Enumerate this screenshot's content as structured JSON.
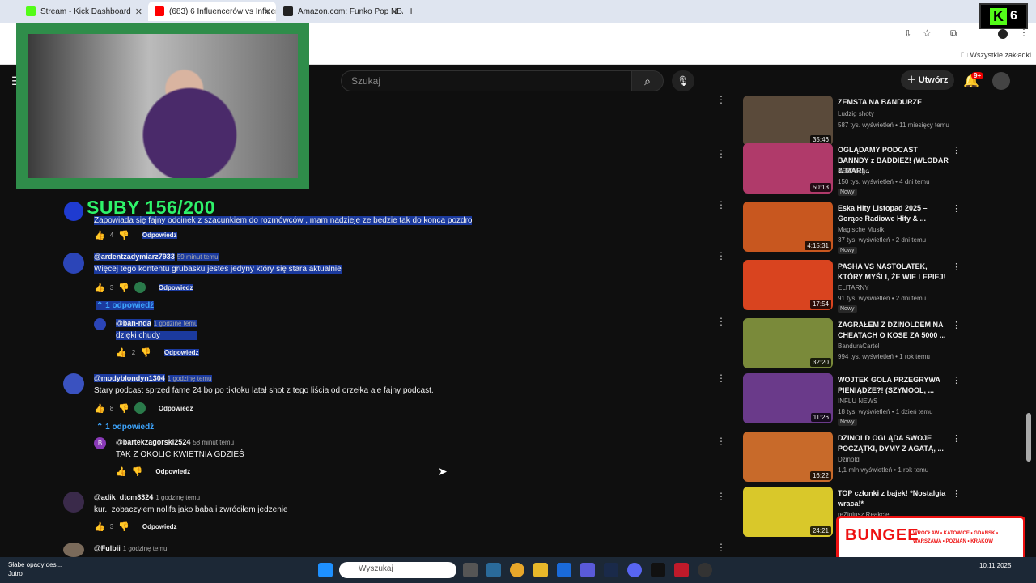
{
  "browser": {
    "tabs": [
      {
        "title": "Stream - Kick Dashboard",
        "color": "#53fc18"
      },
      {
        "title": "(683) 6 Influencerów vs Influenc",
        "color": "#ff0000"
      },
      {
        "title": "Amazon.com: Funko Pop NBA:",
        "color": "#222222"
      }
    ],
    "bookmarks_label": "Wszystkie zakładki"
  },
  "youtube": {
    "search_placeholder": "Szukaj",
    "create_label": "Utwórz",
    "notif_count": "9+"
  },
  "overlay": {
    "subs_text": "SUBY 156/200",
    "kick_count": "6"
  },
  "comments": [
    {
      "author": "",
      "time": "",
      "text": "Zapowiada się fajny odcinek z szacunkiem do rozmówców , mam nadzieje ze bedzie tak do konca pozdro",
      "likes": "4",
      "reply": "Odpowiedz"
    },
    {
      "author": "@ardentzadymiarz7933",
      "time": "59 minut temu",
      "text": "Więcej tego kontentu grubasku jesteś jedyny który się stara aktualnie",
      "likes": "3",
      "reply": "Odpowiedz",
      "replies_label": "1 odpowiedź"
    },
    {
      "author": "@ban-nda",
      "time": "1 godzinę temu",
      "text": "dzięki chudy",
      "likes": "2",
      "reply": "Odpowiedz"
    },
    {
      "author": "@modyblondyn1304",
      "time": "1 godzinę temu",
      "text": "Stary podcast sprzed fame 24 bo po tiktoku latał shot z tego liścia od orzełka ale fajny podcast.",
      "likes": "8",
      "reply": "Odpowiedz",
      "replies_label": "1 odpowiedź"
    },
    {
      "author": "@bartekzagorski2524",
      "time": "58 minut temu",
      "text": "TAK Z OKOLIC KWIETNIA GDZIEŚ",
      "likes": "",
      "reply": "Odpowiedz"
    },
    {
      "author": "@adik_dtcm8324",
      "time": "1 godzinę temu",
      "text": "kur.. zobaczyłem nolifa jako baba i zwróciłem jedzenie",
      "likes": "3",
      "reply": "Odpowiedz"
    },
    {
      "author": "@Fulbii",
      "time": "1 godzinę temu",
      "text": "",
      "likes": "",
      "reply": ""
    }
  ],
  "sidebar_videos": [
    {
      "title": "ZEMSTA NA BANDURZE",
      "channel": "Ludzig shoty",
      "meta": "587 tys. wyświetleń • 11 miesięcy temu",
      "duration": "35:46",
      "new": "",
      "color": "#5a4a3a"
    },
    {
      "title": "OGLĄDAMY PODCAST BANNDY z BADDIEZ! (WŁODAR & MARI...",
      "channel": "NEEXcsgo",
      "meta": "150 tys. wyświetleń • 4 dni temu",
      "duration": "50:13",
      "new": "Nowy",
      "color": "#b03a6a"
    },
    {
      "title": "Eska Hity Listopad 2025 – Gorące Radiowe Hity & ...",
      "channel": "Magische Musik",
      "meta": "37 tys. wyświetleń • 2 dni temu",
      "duration": "4:15:31",
      "new": "Nowy",
      "color": "#c8571f"
    },
    {
      "title": "PASHA VS NASTOLATEK, KTÓRY MYŚLI, ŻE WIE LEPIEJ!",
      "channel": "ELITARNY",
      "meta": "91 tys. wyświetleń • 2 dni temu",
      "duration": "17:54",
      "new": "Nowy",
      "color": "#d9441f"
    },
    {
      "title": "ZAGRAŁEM Z DZINOLDEM NA CHEATACH O KOSE ZA 5000 ...",
      "channel": "BanduraCartel",
      "meta": "994 tys. wyświetleń • 1 rok temu",
      "duration": "32:20",
      "new": "",
      "color": "#7a8a3a"
    },
    {
      "title": "WOJTEK GOLA PRZEGRYWA PIENIĄDZE?! (SZYMOOL, ...",
      "channel": "INFLU NEWS",
      "meta": "18 tys. wyświetleń • 1 dzień temu",
      "duration": "11:26",
      "new": "Nowy",
      "color": "#6a3a8a"
    },
    {
      "title": "DZINOLD OGLĄDA SWOJE POCZĄTKI, DYMY Z AGATĄ, ...",
      "channel": "Dzinold",
      "meta": "1,1 mln wyświetleń • 1 rok temu",
      "duration": "16:22",
      "new": "",
      "color": "#c86a2a"
    },
    {
      "title": "TOP członki z bajek! *Nostalgia wraca!*",
      "channel": "reZigiusz Reakcje",
      "meta": "",
      "duration": "24:21",
      "new": "",
      "color": "#d9c82a"
    }
  ],
  "ad": {
    "brand": "BUNGEE",
    "cities": "WROCŁAW • KATOWICE • GDAŃSK • WARSZAWA • POZNAŃ • KRAKÓW"
  },
  "taskbar": {
    "weather_title": "Słabe opady des...",
    "weather_sub": "Jutro",
    "search_label": "Wyszukaj",
    "date": "10.11.2025"
  }
}
